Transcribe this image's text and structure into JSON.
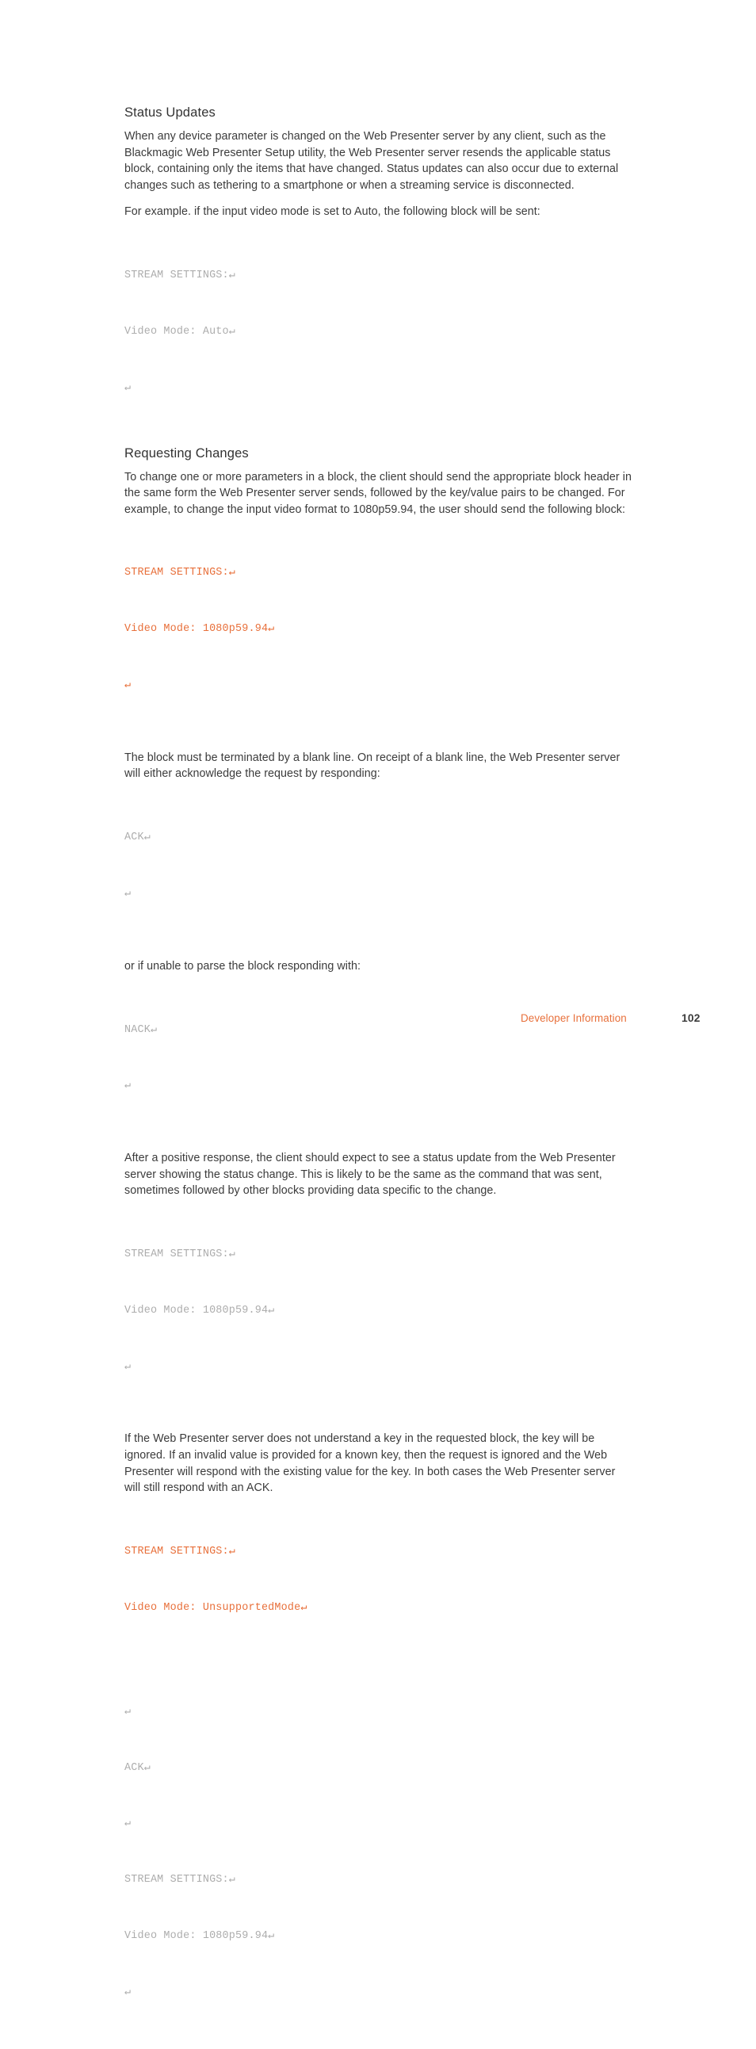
{
  "page": {
    "background": "#ffffff",
    "code_gray": "#adadad",
    "code_orange": "#e8703b",
    "body_color": "#3b3b3b"
  },
  "sections": [
    {
      "heading": "Status Updates",
      "paragraphs": [
        "When any device parameter is changed on the Web Presenter server by any client, such as the Blackmagic Web Presenter Setup utility, the Web Presenter server resends the applicable status block, containing only the items that have changed. Status updates can also occur due to external changes such as tethering to a smartphone or when a streaming service is disconnected.",
        "For example. if the input video mode is set to Auto, the following block will be sent:"
      ],
      "code": {
        "color": "gray",
        "lines": [
          "STREAM SETTINGS:↵",
          "Video Mode: Auto↵",
          "↵"
        ]
      }
    },
    {
      "heading": "Requesting Changes",
      "paragraphs": [
        "To change one or more parameters in a block, the client should send the appropriate block header in the same form the Web Presenter server sends, followed by the key/value pairs to be changed. For example, to change the input video format to 1080p59.94, the user should send the following block:"
      ],
      "code": {
        "color": "orange",
        "lines": [
          "STREAM SETTINGS:↵",
          "Video Mode: 1080p59.94↵",
          "↵"
        ]
      }
    }
  ],
  "blocks": [
    {
      "paragraph": "The block must be terminated by a blank line. On receipt of a blank line, the Web Presenter server will either acknowledge the request by responding:",
      "code": {
        "color": "gray",
        "lines": [
          "ACK↵",
          "↵"
        ]
      }
    },
    {
      "paragraph": "or if unable to parse the block responding with:",
      "code": {
        "color": "gray",
        "lines": [
          "NACK↵",
          "↵"
        ]
      }
    },
    {
      "paragraph": "After a positive response, the client should expect to see a status update from the Web Presenter server showing the status change. This is likely to be the same as the command that was sent, sometimes followed by other blocks providing data specific to the change.",
      "code": {
        "color": "gray",
        "lines": [
          "STREAM SETTINGS:↵",
          "Video Mode: 1080p59.94↵",
          "↵"
        ]
      }
    },
    {
      "paragraph": "If the Web Presenter server does not understand a key in the requested block, the key will be ignored. If an invalid value is provided for a known key, then the request is ignored and the Web Presenter will respond with the existing value for the key. In both cases the Web Presenter server will still respond with an ACK.",
      "code_orange": {
        "color": "orange",
        "lines": [
          "STREAM SETTINGS:↵",
          "Video Mode: UnsupportedMode↵"
        ]
      },
      "code_gray_1": {
        "color": "gray",
        "lines": [
          "↵",
          "ACK↵",
          "↵",
          "STREAM SETTINGS:↵",
          "Video Mode: 1080p59.94↵",
          "↵"
        ]
      }
    }
  ],
  "footer": {
    "label": "Developer Information",
    "page_number": "102"
  }
}
